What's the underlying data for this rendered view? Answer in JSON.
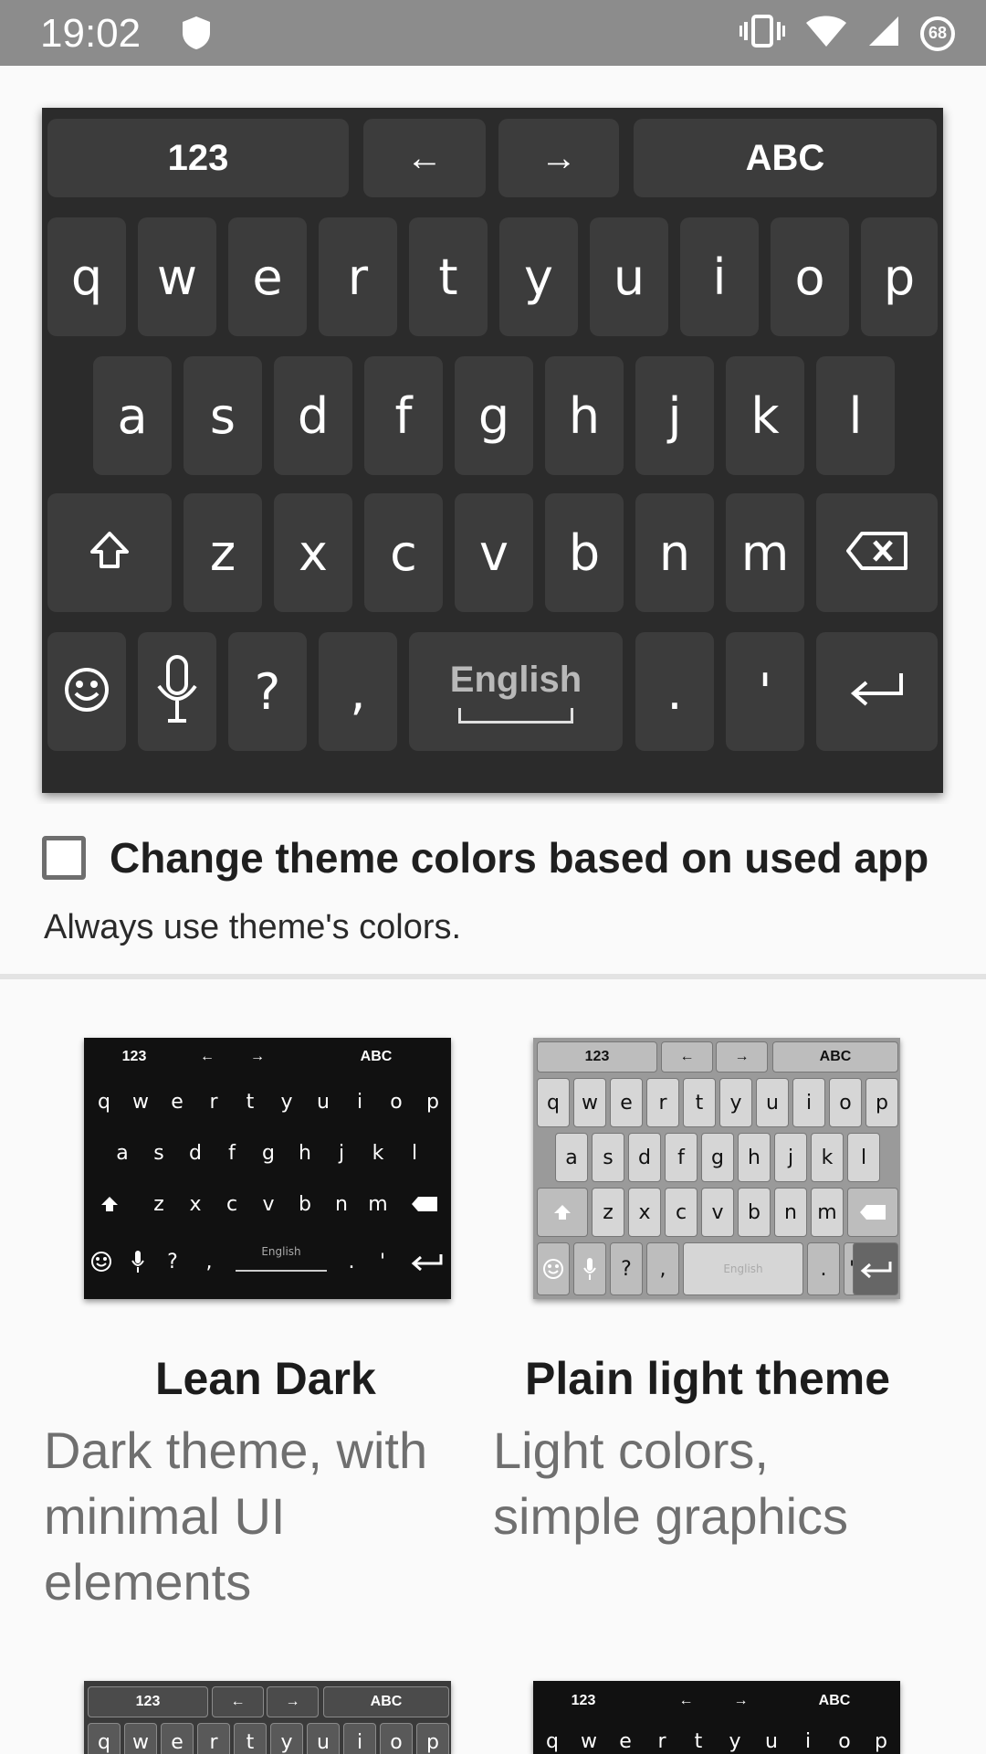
{
  "status_bar": {
    "time": "19:02",
    "battery_level": "68",
    "icons": [
      "shield-icon",
      "vibrate-icon",
      "wifi-icon",
      "signal-icon",
      "battery-icon"
    ]
  },
  "preview_keyboard": {
    "function_row": [
      "123",
      "←",
      "→",
      "ABC"
    ],
    "row1": [
      "q",
      "w",
      "e",
      "r",
      "t",
      "y",
      "u",
      "i",
      "o",
      "p"
    ],
    "row2": [
      "a",
      "s",
      "d",
      "f",
      "g",
      "h",
      "j",
      "k",
      "l"
    ],
    "row3": [
      "z",
      "x",
      "c",
      "v",
      "b",
      "n",
      "m"
    ],
    "bottom": {
      "question": "?",
      "comma": ",",
      "space_label": "English",
      "period": ".",
      "apostrophe": "'"
    }
  },
  "setting": {
    "title": "Change theme colors based on used app",
    "summary": "Always use theme's colors.",
    "checked": false
  },
  "themes": [
    {
      "title": "Lean Dark",
      "description": "Dark theme, with minimal UI elements"
    },
    {
      "title": "Plain light theme",
      "description": "Light colors, simple graphics"
    }
  ],
  "thumb_keys": {
    "function_row": [
      "123",
      "←",
      "→",
      "ABC"
    ],
    "row1": [
      "q",
      "w",
      "e",
      "r",
      "t",
      "y",
      "u",
      "i",
      "o",
      "p"
    ],
    "row2": [
      "a",
      "s",
      "d",
      "f",
      "g",
      "h",
      "j",
      "k",
      "l"
    ],
    "row3": [
      "z",
      "x",
      "c",
      "v",
      "b",
      "n",
      "m"
    ],
    "bottom": [
      "?",
      ",",
      "English",
      ".",
      "'"
    ]
  }
}
